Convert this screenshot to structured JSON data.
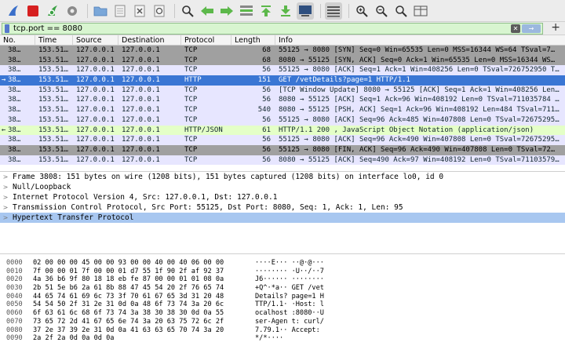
{
  "toolbar": {
    "icons": [
      "shark-fin-icon",
      "stop-icon",
      "restart-icon",
      "options-gear-icon",
      "open-folder-icon",
      "save-file-icon",
      "close-file-icon",
      "reload-icon",
      "find-magnifier-icon",
      "go-back-icon",
      "go-forward-icon",
      "go-to-packet-icon",
      "first-packet-icon",
      "last-packet-icon",
      "autoscroll-icon",
      "colorize-icon",
      "zoom-in-icon",
      "zoom-out-icon",
      "zoom-normal-icon",
      "resize-columns-icon"
    ]
  },
  "filter": {
    "value": "tcp.port == 8080",
    "clear_label": "✕",
    "apply_label": "→",
    "add_label": "+"
  },
  "packet_list": {
    "columns": [
      "No.",
      "Time",
      "Source",
      "Destination",
      "Protocol",
      "Length",
      "Info"
    ],
    "rows": [
      {
        "no": "38…",
        "time": "153.51…",
        "src": "127.0.0.1",
        "dst": "127.0.0.1",
        "proto": "TCP",
        "len": "68",
        "info": "55125 → 8080 [SYN] Seq=0 Win=65535 Len=0 MSS=16344 WS=64 TSval=7…",
        "style": "syn",
        "mark": ""
      },
      {
        "no": "38…",
        "time": "153.51…",
        "src": "127.0.0.1",
        "dst": "127.0.0.1",
        "proto": "TCP",
        "len": "68",
        "info": "8080 → 55125 [SYN, ACK] Seq=0 Ack=1 Win=65535 Len=0 MSS=16344 WS…",
        "style": "syn",
        "mark": ""
      },
      {
        "no": "38…",
        "time": "153.51…",
        "src": "127.0.0.1",
        "dst": "127.0.0.1",
        "proto": "TCP",
        "len": "56",
        "info": "55125 → 8080 [ACK] Seq=1 Ack=1 Win=408256 Len=0 TSval=726752950 T…",
        "style": "tcp",
        "mark": ""
      },
      {
        "no": "38…",
        "time": "153.51…",
        "src": "127.0.0.1",
        "dst": "127.0.0.1",
        "proto": "HTTP",
        "len": "151",
        "info": "GET /vetDetails?page=1 HTTP/1.1",
        "style": "http-sel",
        "mark": "→"
      },
      {
        "no": "38…",
        "time": "153.51…",
        "src": "127.0.0.1",
        "dst": "127.0.0.1",
        "proto": "TCP",
        "len": "56",
        "info": "[TCP Window Update] 8080 → 55125 [ACK] Seq=1 Ack=1 Win=408256 Len…",
        "style": "tcp",
        "mark": ""
      },
      {
        "no": "38…",
        "time": "153.51…",
        "src": "127.0.0.1",
        "dst": "127.0.0.1",
        "proto": "TCP",
        "len": "56",
        "info": "8080 → 55125 [ACK] Seq=1 Ack=96 Win=408192 Len=0 TSval=711035784 …",
        "style": "tcp",
        "mark": ""
      },
      {
        "no": "38…",
        "time": "153.51…",
        "src": "127.0.0.1",
        "dst": "127.0.0.1",
        "proto": "TCP",
        "len": "540",
        "info": "8080 → 55125 [PSH, ACK] Seq=1 Ack=96 Win=408192 Len=484 TSval=711…",
        "style": "tcp",
        "mark": ""
      },
      {
        "no": "38…",
        "time": "153.51…",
        "src": "127.0.0.1",
        "dst": "127.0.0.1",
        "proto": "TCP",
        "len": "56",
        "info": "55125 → 8080 [ACK] Seq=96 Ack=485 Win=407808 Len=0 TSval=72675295…",
        "style": "tcp",
        "mark": ""
      },
      {
        "no": "38…",
        "time": "153.51…",
        "src": "127.0.0.1",
        "dst": "127.0.0.1",
        "proto": "HTTP/JSON",
        "len": "61",
        "info": "HTTP/1.1 200  , JavaScript Object Notation (application/json)",
        "style": "http",
        "mark": "←"
      },
      {
        "no": "38…",
        "time": "153.51…",
        "src": "127.0.0.1",
        "dst": "127.0.0.1",
        "proto": "TCP",
        "len": "56",
        "info": "55125 → 8080 [ACK] Seq=96 Ack=490 Win=407808 Len=0 TSval=72675295…",
        "style": "tcp",
        "mark": ""
      },
      {
        "no": "38…",
        "time": "153.51…",
        "src": "127.0.0.1",
        "dst": "127.0.0.1",
        "proto": "TCP",
        "len": "56",
        "info": "55125 → 8080 [FIN, ACK] Seq=96 Ack=490 Win=407808 Len=0 TSval=72…",
        "style": "syn",
        "mark": ""
      },
      {
        "no": "38…",
        "time": "153.51…",
        "src": "127.0.0.1",
        "dst": "127.0.0.1",
        "proto": "TCP",
        "len": "56",
        "info": "8080 → 55125 [ACK] Seq=490 Ack=97 Win=408192 Len=0 TSval=71103579…",
        "style": "tcp",
        "mark": ""
      }
    ]
  },
  "details": {
    "rows": [
      {
        "text": "Frame 3808: 151 bytes on wire (1208 bits), 151 bytes captured (1208 bits) on interface lo0, id 0",
        "selected": false
      },
      {
        "text": "Null/Loopback",
        "selected": false
      },
      {
        "text": "Internet Protocol Version 4, Src: 127.0.0.1, Dst: 127.0.0.1",
        "selected": false
      },
      {
        "text": "Transmission Control Protocol, Src Port: 55125, Dst Port: 8080, Seq: 1, Ack: 1, Len: 95",
        "selected": false
      },
      {
        "text": "Hypertext Transfer Protocol",
        "selected": true
      }
    ],
    "expander_glyph": ">"
  },
  "bytes": {
    "rows": [
      {
        "off": "0000",
        "hex": "02 00 00 00 45 00 00 93  00 00 40 00 40 06 00 00",
        "ascii": "····E··· ··@·@···"
      },
      {
        "off": "0010",
        "hex": "7f 00 00 01 7f 00 00 01  d7 55 1f 90 2f af 92 37",
        "ascii": "········ ·U··/··7"
      },
      {
        "off": "0020",
        "hex": "4a 36 b6 9f 80 18 18 eb  fe 87 00 00 01 01 08 0a",
        "ascii": "J6······ ········"
      },
      {
        "off": "0030",
        "hex": "2b 51 5e b6 2a 61 8b 88  47 45 54 20 2f 76 65 74",
        "ascii": "+Q^·*a·· GET /vet"
      },
      {
        "off": "0040",
        "hex": "44 65 74 61 69 6c 73 3f  70 61 67 65 3d 31 20 48",
        "ascii": "Details? page=1 H"
      },
      {
        "off": "0050",
        "hex": "54 54 50 2f 31 2e 31 0d  0a 48 6f 73 74 3a 20 6c",
        "ascii": "TTP/1.1· ·Host: l"
      },
      {
        "off": "0060",
        "hex": "6f 63 61 6c 68 6f 73 74  3a 38 30 38 30 0d 0a 55",
        "ascii": "ocalhost :8080··U"
      },
      {
        "off": "0070",
        "hex": "73 65 72 2d 41 67 65 6e  74 3a 20 63 75 72 6c 2f",
        "ascii": "ser-Agen t: curl/"
      },
      {
        "off": "0080",
        "hex": "37 2e 37 39 2e 31 0d 0a  41 63 63 65 70 74 3a 20",
        "ascii": "7.79.1·· Accept: "
      },
      {
        "off": "0090",
        "hex": "2a 2f 2a 0d 0a 0d 0a",
        "ascii": "*/*····"
      }
    ]
  }
}
